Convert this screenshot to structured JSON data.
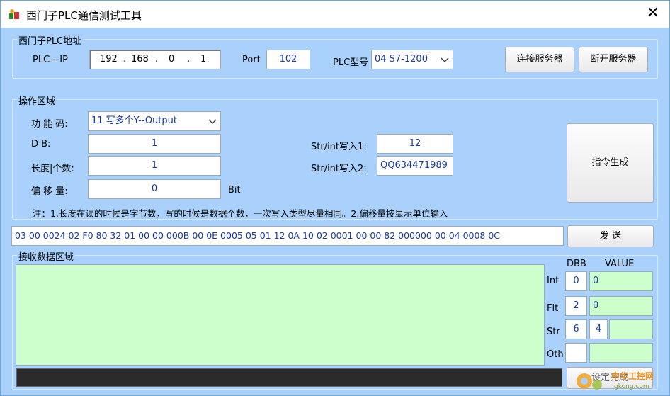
{
  "window": {
    "title": "西门子PLC通信测试工具",
    "close_glyph": "✕"
  },
  "plc_address": {
    "group_label": "西门子PLC地址",
    "ip_label": "PLC---IP",
    "ip_parts": [
      "192",
      "168",
      "0",
      "1"
    ],
    "ip_dot": ".",
    "port_label": "Port",
    "port_value": "102",
    "model_label": "PLC型号",
    "model_value": "04 S7-1200",
    "connect_button": "连接服务器",
    "disconnect_button": "断开服务器"
  },
  "operation": {
    "group_label": "操作区域",
    "func_code_label": "功  能  码:",
    "func_code_value": "11 写多个Y--Output",
    "db_label": "D          B:",
    "db_value": "1",
    "length_label": "长度|个数:",
    "length_value": "1",
    "offset_label": "偏  移  量:",
    "offset_value": "0",
    "offset_unit": "Bit",
    "write1_label": "Str/int写入1:",
    "write1_value": "12",
    "write2_label": "Str/int写入2:",
    "write2_value": "QQ634471989",
    "generate_button": "指令生成",
    "note": "注：1.长度在读的时候是字节数，写的时候是数据个数，一次写入类型尽量相同。2.偏移量按显示单位输入"
  },
  "send": {
    "command_value": "03 00 0024 02 F0 80 32 01 00 00 000B 00 0E 0005 05 01 12 0A 10 02 0001 00 00 82 000000 00 04 0008 0C",
    "send_button": "发    送"
  },
  "receive": {
    "group_label": "接收数据区域",
    "dbb_header": "DBB",
    "value_header": "VALUE",
    "rows": [
      {
        "label": "Int",
        "dbb": "0",
        "value": "0"
      },
      {
        "label": "Flt",
        "dbb": "2",
        "value": "0"
      },
      {
        "label": "Str",
        "dbb": "6",
        "extra": "4",
        "value": ""
      },
      {
        "label": "Oth",
        "dbb": "",
        "value": ""
      }
    ],
    "setting_button": "设定完成"
  },
  "watermark": {
    "text": "中华工控网",
    "sub": "gkong.com"
  },
  "colors": {
    "window_bg": "#a9d1fb",
    "green": "#ccffcc",
    "value_text": "#1a3a9a",
    "status_bar": "#2b2b2b"
  }
}
